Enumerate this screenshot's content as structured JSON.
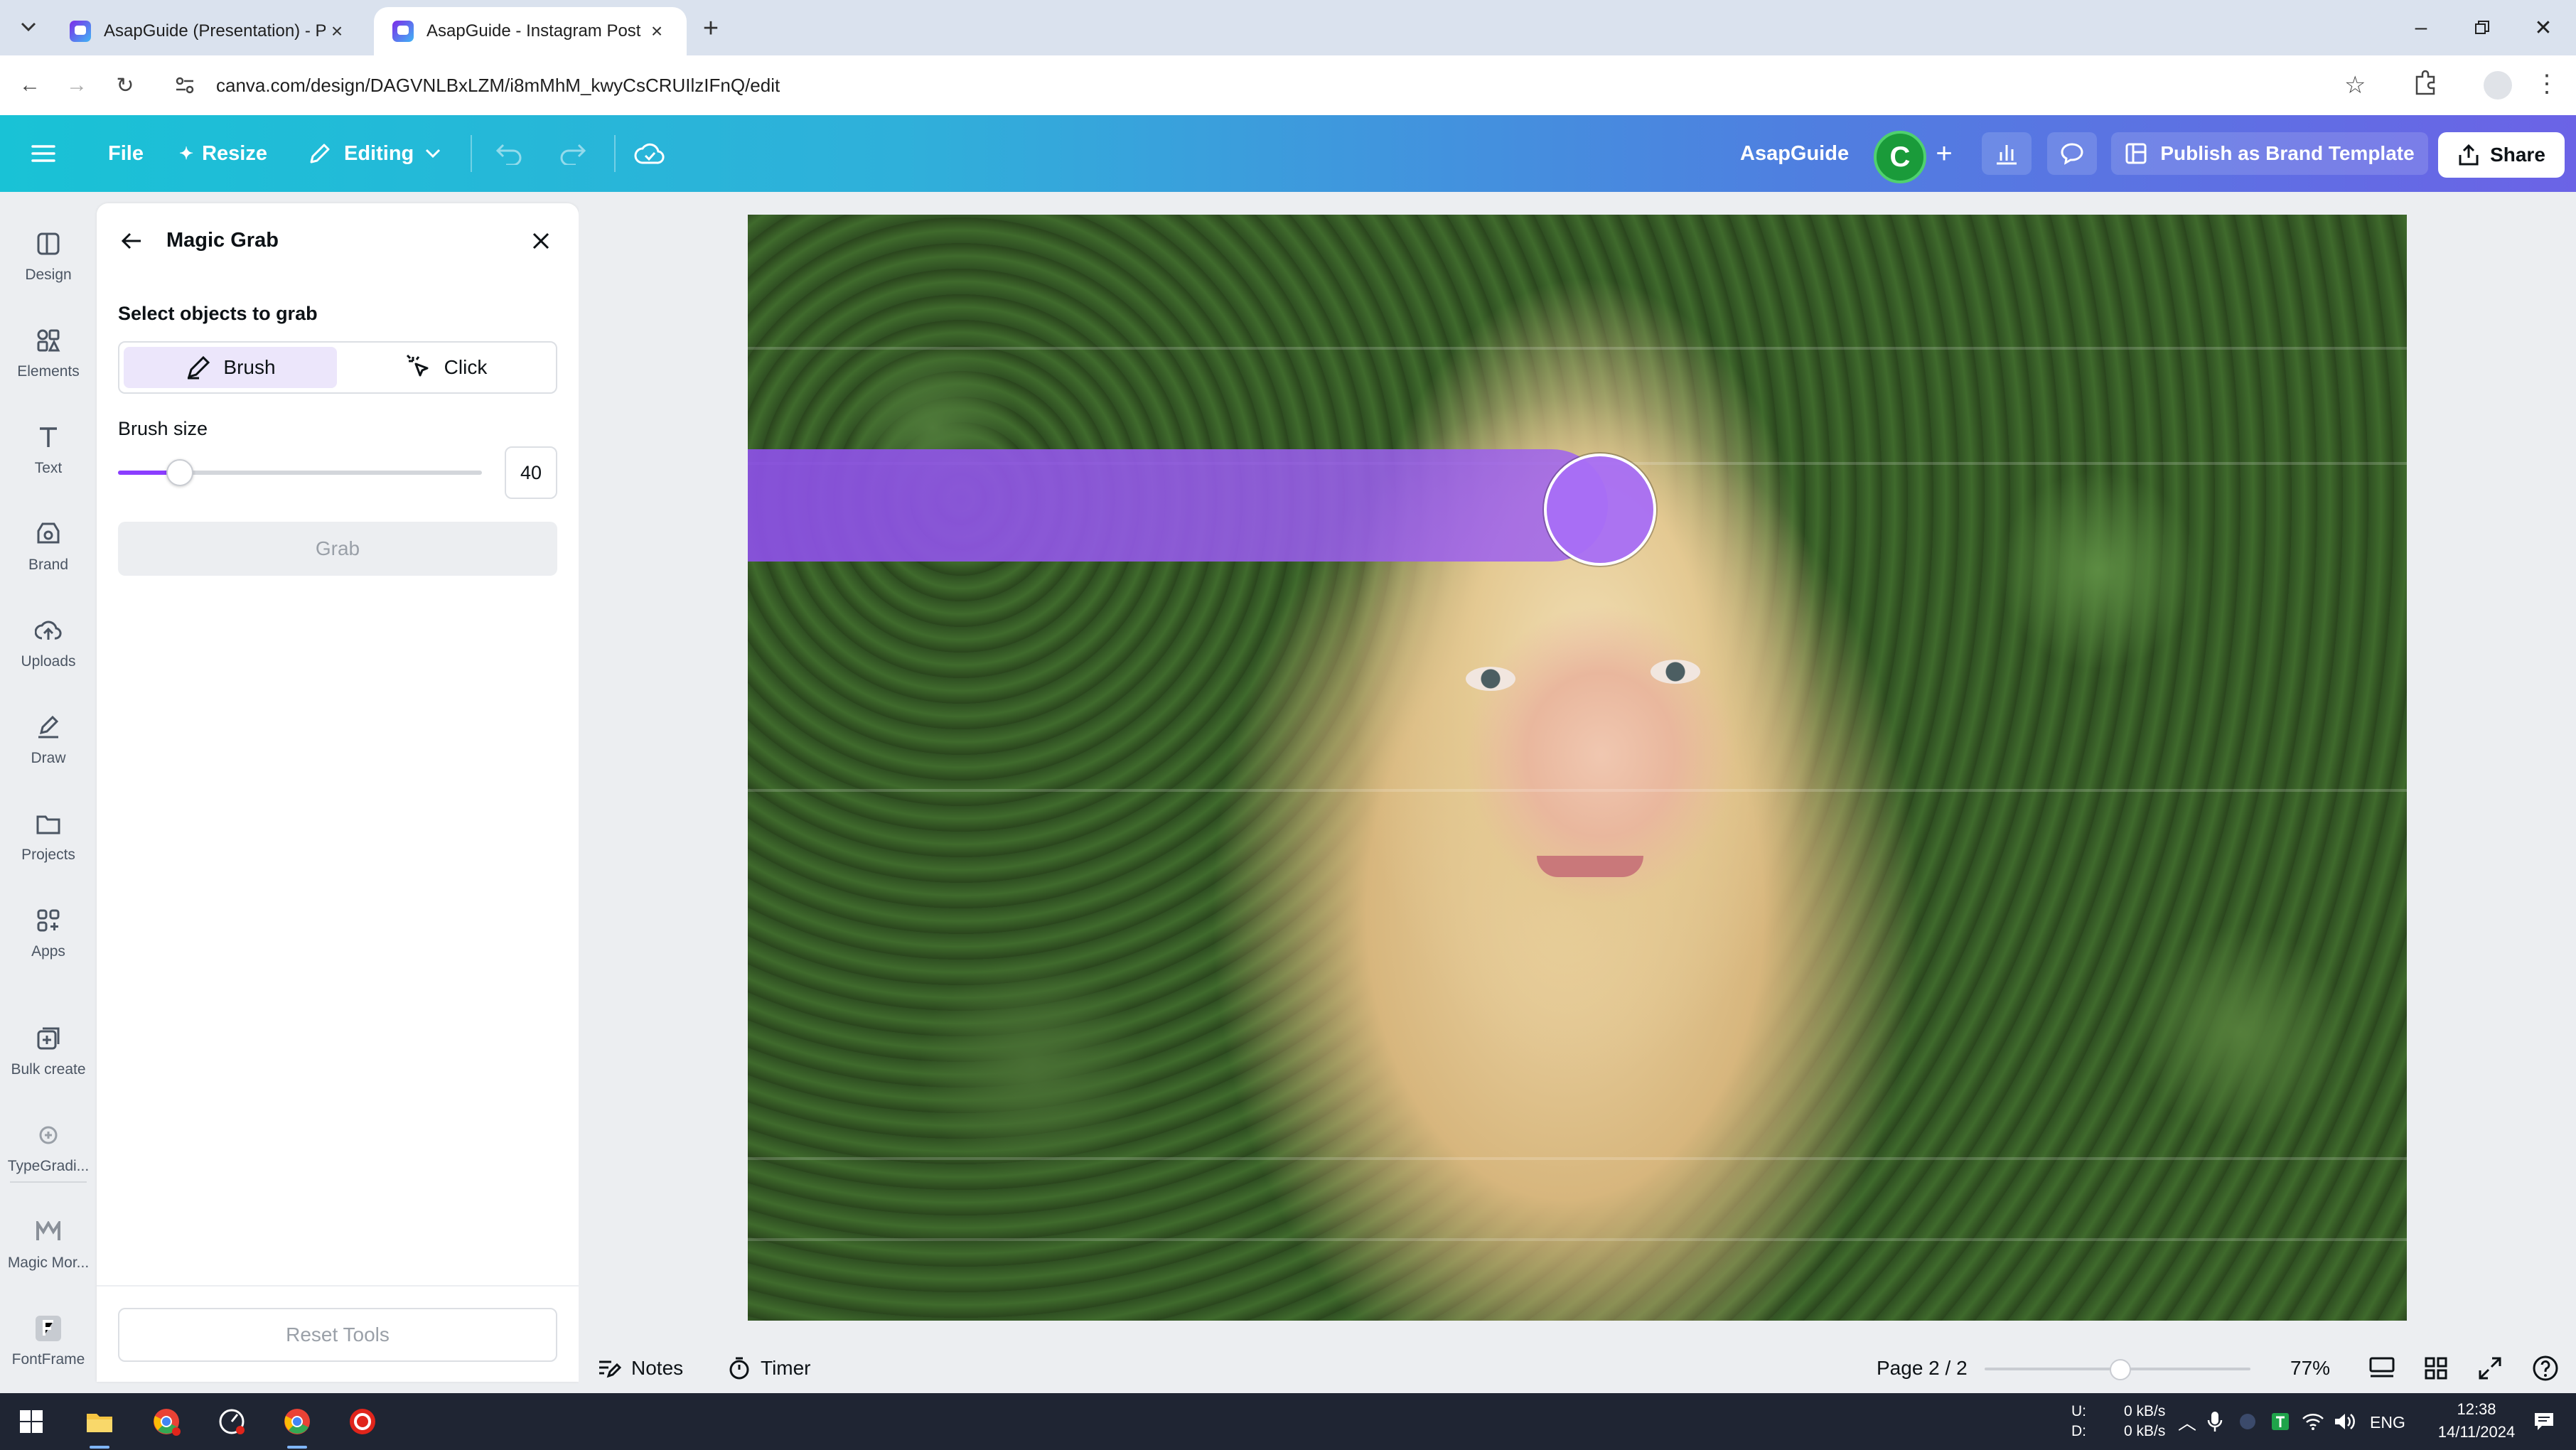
{
  "browser": {
    "tabs": [
      {
        "title": "AsapGuide (Presentation) - Pre",
        "active": false
      },
      {
        "title": "AsapGuide - Instagram Post",
        "active": true
      }
    ],
    "url": "canva.com/design/DAGVNLBxLZM/i8mMhM_kwyCsCRUIlzIFnQ/edit"
  },
  "header": {
    "file": "File",
    "resize": "Resize",
    "editing": "Editing",
    "team_name": "AsapGuide",
    "avatar_letter": "C",
    "publish": "Publish as Brand Template",
    "share": "Share"
  },
  "rail": [
    {
      "label": "Design",
      "icon": "design-icon"
    },
    {
      "label": "Elements",
      "icon": "elements-icon"
    },
    {
      "label": "Text",
      "icon": "text-icon"
    },
    {
      "label": "Brand",
      "icon": "brand-icon"
    },
    {
      "label": "Uploads",
      "icon": "uploads-icon"
    },
    {
      "label": "Draw",
      "icon": "draw-icon"
    },
    {
      "label": "Projects",
      "icon": "projects-icon"
    },
    {
      "label": "Apps",
      "icon": "apps-icon"
    },
    {
      "label": "Bulk create",
      "icon": "bulk-create-icon"
    },
    {
      "label": "TypeGradi...",
      "icon": "typegradient-icon"
    },
    {
      "label": "Magic Mor...",
      "icon": "magic-morph-icon"
    },
    {
      "label": "FontFrame",
      "icon": "fontframe-icon"
    }
  ],
  "panel": {
    "title": "Magic Grab",
    "select_label": "Select objects to grab",
    "mode_brush": "Brush",
    "mode_click": "Click",
    "brush_size_label": "Brush size",
    "brush_size_value": "40",
    "brush_size_fraction": 0.17,
    "grab": "Grab",
    "reset": "Reset Tools"
  },
  "footer": {
    "notes": "Notes",
    "timer": "Timer",
    "page": "Page 2 / 2",
    "zoom": "77%"
  },
  "taskbar": {
    "net_up_label": "U:",
    "net_down_label": "D:",
    "net_up": "0 kB/s",
    "net_down": "0 kB/s",
    "lang": "ENG",
    "time": "12:38",
    "date": "14/11/2024"
  },
  "colors": {
    "accent": "#8b3dff",
    "header_start": "#19c2d6",
    "header_end": "#6b63e6",
    "avatar": "#1a9b3a"
  }
}
